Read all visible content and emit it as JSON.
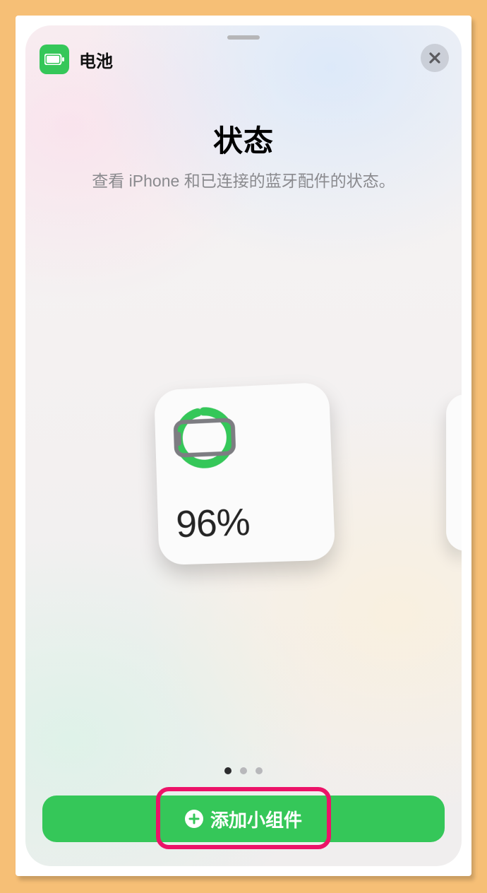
{
  "header": {
    "app_name": "电池",
    "close_icon": "close-icon"
  },
  "title": "状态",
  "subtitle": "查看 iPhone 和已连接的蓝牙配件的状态。",
  "widget": {
    "battery_percent_value": 96,
    "battery_percent_label": "96%",
    "ring_color": "#35c759"
  },
  "pager": {
    "count": 3,
    "active_index": 0
  },
  "add_button": {
    "label": "添加小组件"
  }
}
